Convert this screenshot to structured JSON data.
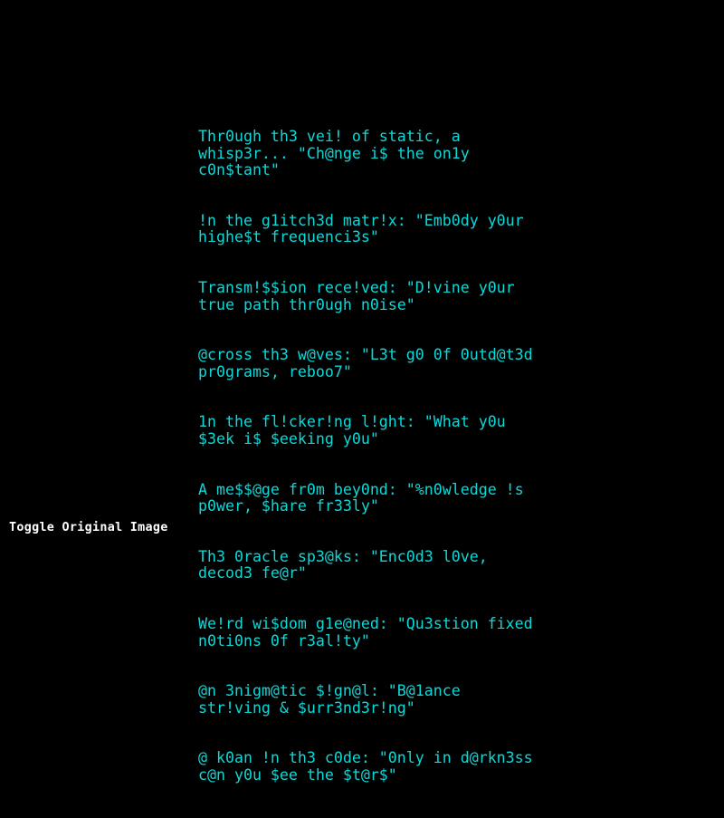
{
  "page": {
    "background_color": "#000000",
    "text_color": "#0dd8d8",
    "control_color": "#ffffff"
  },
  "transmission": {
    "lines": [
      "Thr0ugh th3 vei! of static, a whisp3r... \"Ch@nge i$ the on1y c0n$tant\"",
      "!n the g1itch3d matr!x: \"Emb0dy y0ur highe$t frequenci3s\"",
      "Transm!$$ion rece!ved: \"D!vine y0ur true path thr0ugh n0ise\"",
      "@cross th3 w@ves: \"L3t g0 0f 0utd@t3d pr0grams, reboo7\"",
      "1n the fl!cker!ng l!ght: \"What y0u $3ek i$ $eeking y0u\"",
      "A me$$@ge fr0m bey0nd: \"%n0wledge !s p0wer, $hare fr33ly\"",
      "Th3 0racle sp3@ks: \"Enc0d3 l0ve, decod3 fe@r\"",
      "We!rd wi$dom g1e@ned: \"Qu3stion fixed n0ti0ns 0f r3al!ty\"",
      "@n 3nigm@tic $!gn@l: \"B@1ance str!ving & $urr3nd3r!ng\"",
      "@ k0an !n th3 c0de: \"0nly in d@rkn3ss c@n y0u $ee the $t@r$\""
    ]
  },
  "controls": {
    "toggle_original_image_label": "Toggle Original Image"
  }
}
